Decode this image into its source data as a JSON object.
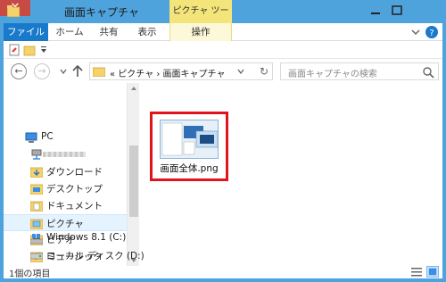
{
  "window": {
    "title": "画面キャプチャ",
    "tools_context_tab": "ピクチャ ツール",
    "close_glyph": "✕"
  },
  "ribbon": {
    "tabs": [
      "ファイル",
      "ホーム",
      "共有",
      "表示",
      "操作"
    ]
  },
  "navigation": {
    "back_glyph": "←",
    "forward_glyph": "→",
    "address": "« ピクチャ › 画面キャプチャ",
    "refresh_glyph": "↻",
    "search_placeholder": "画面キャプチャの検索"
  },
  "nav_pane": {
    "items": [
      {
        "label": "PC",
        "icon": "pc-icon"
      },
      {
        "label": "",
        "icon": "network-drive-icon"
      },
      {
        "label": "ダウンロード",
        "icon": "download-folder-icon"
      },
      {
        "label": "デスクトップ",
        "icon": "desktop-folder-icon"
      },
      {
        "label": "ドキュメント",
        "icon": "documents-folder-icon"
      },
      {
        "label": "ピクチャ",
        "icon": "pictures-folder-icon",
        "selected": true
      },
      {
        "label": "ビデオ",
        "icon": "videos-folder-icon"
      },
      {
        "label": "ミュージック",
        "icon": "music-folder-icon"
      },
      {
        "label": "Windows 8.1 (C:)",
        "icon": "windows-drive-icon"
      },
      {
        "label": "ローカル ディスク (D:)",
        "icon": "disk-drive-icon"
      }
    ]
  },
  "content": {
    "files": [
      {
        "name": "画面全体.png",
        "highlighted": true
      }
    ]
  },
  "status": {
    "item_count": "1個の項目"
  },
  "colors": {
    "accent": "#1979ca",
    "title_bar": "#4fa3dd",
    "tools_tab": "#f4e57a",
    "highlight_border": "#e1141d",
    "close_button": "#c74a45"
  }
}
